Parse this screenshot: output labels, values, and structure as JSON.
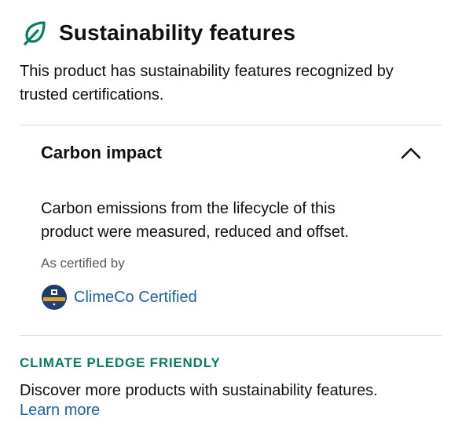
{
  "header": {
    "icon": "leaf-icon",
    "title": "Sustainability features"
  },
  "intro": "This product has sustainability features recognized by trusted certifications.",
  "section": {
    "title": "Carbon impact",
    "expanded": true,
    "toggle_icon": "chevron-up-icon",
    "description": "Carbon emissions from the lifecycle of this product were measured, reduced and offset.",
    "certified_by_label": "As certified by",
    "certification": {
      "icon": "climeco-badge-icon",
      "label": "ClimeCo Certified"
    }
  },
  "footer": {
    "pledge_label": "CLIMATE PLEDGE FRIENDLY",
    "description": "Discover more products with sustainability features.",
    "learn_more": "Learn more"
  },
  "colors": {
    "accent_green": "#067d62",
    "link_blue": "#2162a1",
    "text": "#0f1111",
    "muted": "#565959",
    "divider": "#d5d9d9"
  }
}
